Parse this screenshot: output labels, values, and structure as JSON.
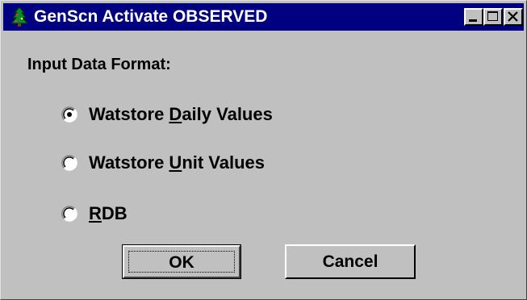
{
  "window": {
    "title": "GenScn Activate OBSERVED",
    "icon": "tree-icon"
  },
  "titlebar_buttons": {
    "minimize": "minimize-icon",
    "maximize": "maximize-icon",
    "close": "close-icon"
  },
  "form": {
    "section_label": "Input Data Format:",
    "options": [
      {
        "prefix": "Watstore ",
        "accel": "D",
        "suffix": "aily Values",
        "checked": true
      },
      {
        "prefix": "Watstore ",
        "accel": "U",
        "suffix": "nit Values",
        "checked": false
      },
      {
        "prefix": "",
        "accel": "R",
        "suffix": "DB",
        "checked": false
      }
    ]
  },
  "buttons": {
    "ok": "OK",
    "cancel": "Cancel"
  },
  "colors": {
    "titlebar": "#000080",
    "face": "#c0c0c0"
  }
}
